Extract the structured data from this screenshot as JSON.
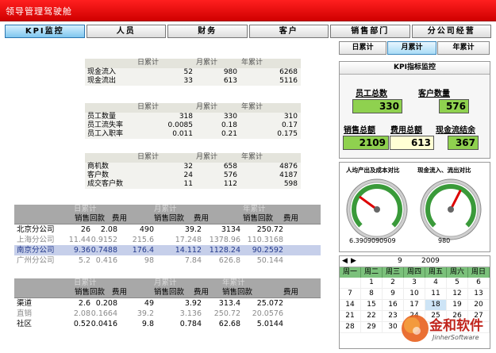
{
  "window": {
    "title": "领导管理驾驶舱"
  },
  "nav": {
    "tabs": [
      "KPI监控",
      "人员",
      "财务",
      "客户",
      "销售部门",
      "分公司经营"
    ],
    "active": 0
  },
  "period_tabs": {
    "items": [
      "日累计",
      "月累计",
      "年累计"
    ],
    "selected": 1
  },
  "cash_table": {
    "headers": [
      "日累计",
      "月累计",
      "年累计"
    ],
    "rows": [
      {
        "label": "现金流入",
        "d": "52",
        "m": "980",
        "y": "6268"
      },
      {
        "label": "现金流出",
        "d": "33",
        "m": "613",
        "y": "5116"
      }
    ]
  },
  "staff_table": {
    "headers": [
      "日累计",
      "月累计",
      "年累计"
    ],
    "rows": [
      {
        "label": "员工数量",
        "d": "318",
        "m": "330",
        "y": "310"
      },
      {
        "label": "员工流失率",
        "d": "0.0085",
        "m": "0.18",
        "y": "0.17"
      },
      {
        "label": "员工入职率",
        "d": "0.011",
        "m": "0.21",
        "y": "0.175"
      }
    ]
  },
  "biz_table": {
    "headers": [
      "日累计",
      "月累计",
      "年累计"
    ],
    "rows": [
      {
        "label": "商机数",
        "d": "32",
        "m": "658",
        "y": "4876"
      },
      {
        "label": "客户数",
        "d": "24",
        "m": "576",
        "y": "4187"
      },
      {
        "label": "成交客户数",
        "d": "11",
        "m": "112",
        "y": "598"
      }
    ]
  },
  "branch_table": {
    "group_headers": [
      "日累计",
      "月累计",
      "年累计"
    ],
    "sub_headers": [
      "销售回款",
      "费用",
      "销售回款",
      "费用",
      "销售回款",
      "费用"
    ],
    "rows": [
      {
        "name": "北京分公司",
        "v": [
          "26",
          "2.08",
          "490",
          "39.2",
          "3134",
          "250.72"
        ],
        "style": ""
      },
      {
        "name": "上海分公司",
        "v": [
          "11.44",
          "0.9152",
          "215.6",
          "17.248",
          "1378.96",
          "110.3168"
        ],
        "style": "g"
      },
      {
        "name": "南京分公司",
        "v": [
          "9.36",
          "0.7488",
          "176.4",
          "14.112",
          "1128.24",
          "90.2592"
        ],
        "style": "sel"
      },
      {
        "name": "广州分公司",
        "v": [
          "5.2",
          "0.416",
          "98",
          "7.84",
          "626.8",
          "50.144"
        ],
        "style": "g"
      }
    ]
  },
  "channel_table": {
    "group_headers": [
      "日累计",
      "月累计",
      "年累计"
    ],
    "sub_headers": [
      "销售回款",
      "费用",
      "销售回款",
      "费用",
      "销售回款",
      "费用"
    ],
    "rows": [
      {
        "name": "渠道",
        "v": [
          "2.6",
          "0.208",
          "49",
          "3.92",
          "313.4",
          "25.072"
        ],
        "style": ""
      },
      {
        "name": "直销",
        "v": [
          "2.08",
          "0.1664",
          "39.2",
          "3.136",
          "250.72",
          "20.0576"
        ],
        "style": "g"
      },
      {
        "name": "社区",
        "v": [
          "0.52",
          "0.0416",
          "9.8",
          "0.784",
          "62.68",
          "5.0144"
        ],
        "style": ""
      }
    ]
  },
  "kpi": {
    "title": "KPI指标监控",
    "staff_label": "员工总数",
    "staff_value": "330",
    "customer_label": "客户数量",
    "customer_value": "576",
    "sales_label": "销售总额",
    "sales_value": "2109",
    "cost_label": "费用总额",
    "cost_value": "613",
    "cash_label": "现金流结余",
    "cash_value": "367"
  },
  "gauges": {
    "left_title": "人均产出及成本对比",
    "left_value": "6.3909090909",
    "left_fraction": 0.3,
    "right_title": "现金流入、流出对比",
    "right_value": "980",
    "right_fraction": 0.6
  },
  "calendar": {
    "month": "9",
    "year": "2009",
    "prev": "◀",
    "next": "▶",
    "weekdays": [
      "周一",
      "周二",
      "周三",
      "周四",
      "周五",
      "周六",
      "周日"
    ],
    "days": [
      "",
      "1",
      "2",
      "3",
      "4",
      "5",
      "6",
      "7",
      "8",
      "9",
      "10",
      "11",
      "12",
      "13",
      "14",
      "15",
      "16",
      "17",
      "18",
      "19",
      "20",
      "21",
      "22",
      "23",
      "24",
      "25",
      "26",
      "27",
      "28",
      "29",
      "30",
      "",
      "",
      "",
      ""
    ],
    "today": "18"
  },
  "logo": {
    "text": "金和软件",
    "sub": "JinherSoftware"
  },
  "colors": {
    "title_red": "#e00000",
    "gauge_green": "#3a9a3a",
    "kpi_green": "#8fd14f"
  }
}
